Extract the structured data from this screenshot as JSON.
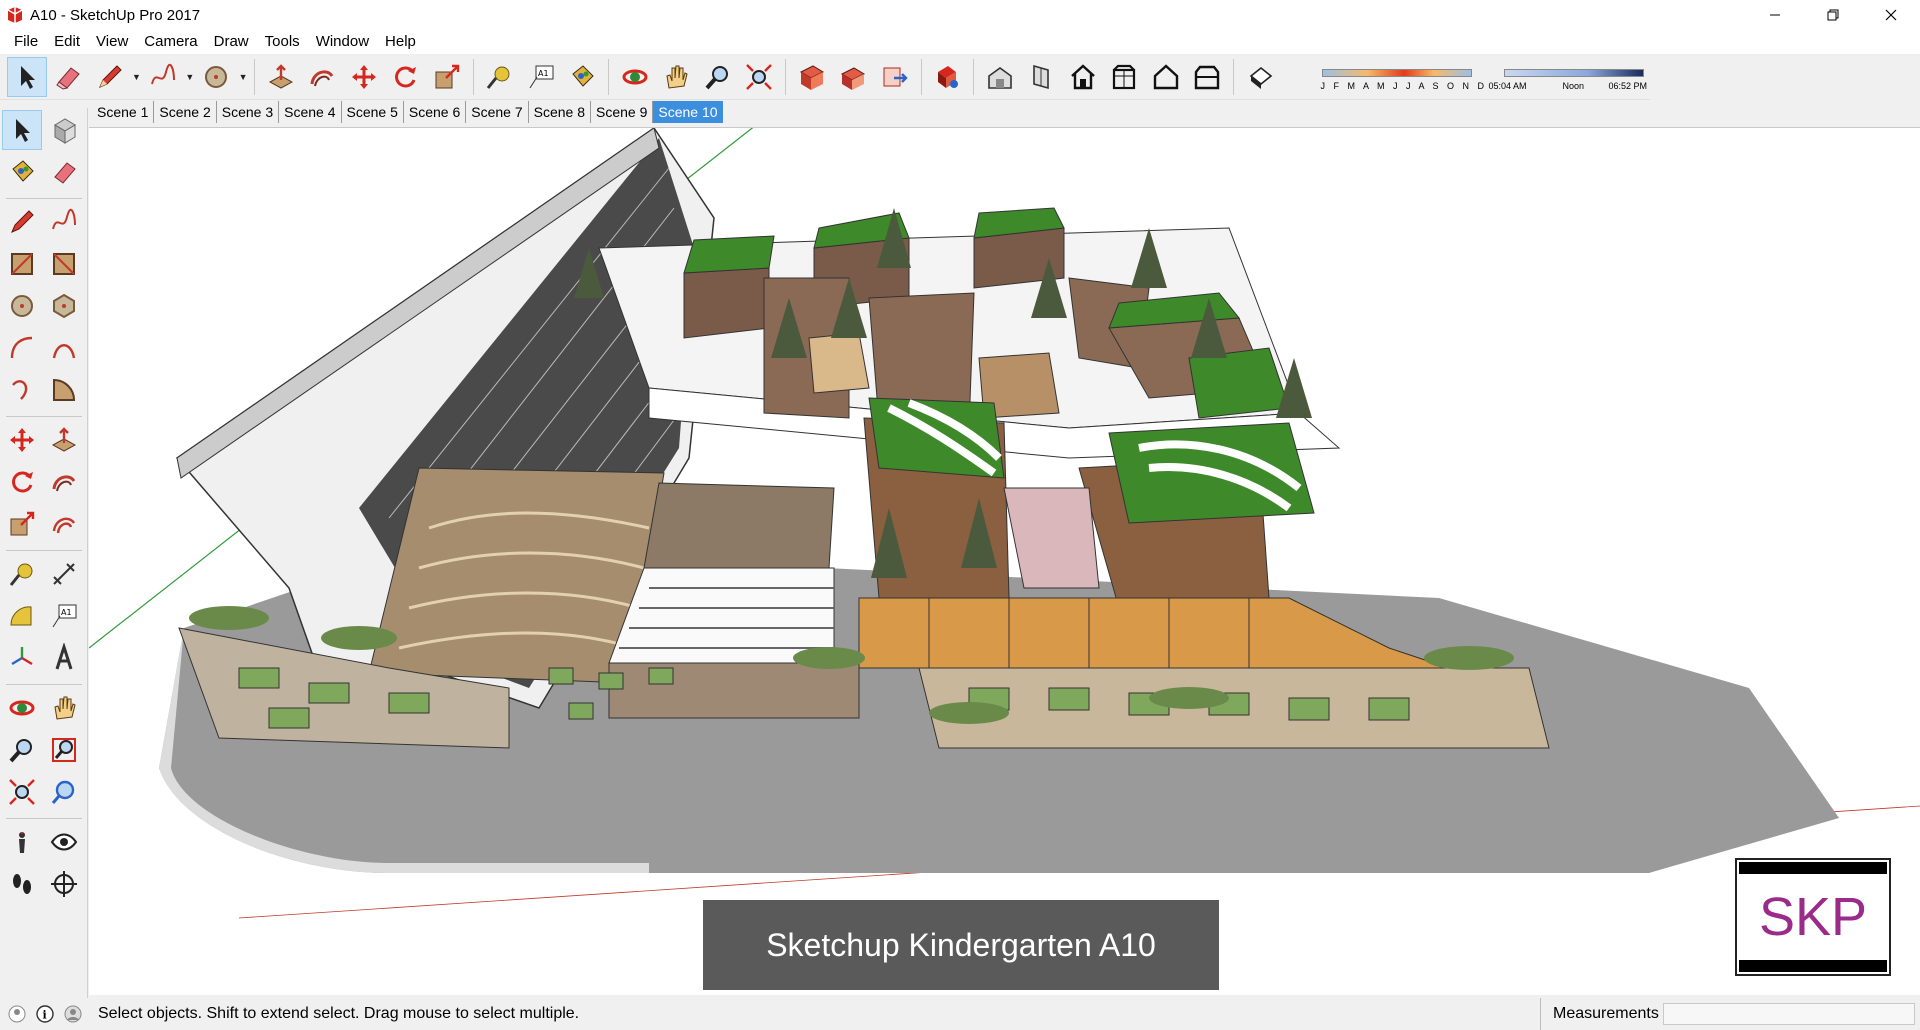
{
  "window": {
    "title": "A10 - SketchUp Pro 2017",
    "app_icon": "sketchup-logo-icon",
    "controls": [
      "minimize-icon",
      "restore-icon",
      "close-icon"
    ]
  },
  "menu": [
    "File",
    "Edit",
    "View",
    "Camera",
    "Draw",
    "Tools",
    "Window",
    "Help"
  ],
  "toolbar": {
    "tools": [
      "select-arrow-icon",
      "eraser-icon",
      "pencil-icon",
      "freehand-icon",
      "circle-icon",
      "push-pull-icon",
      "follow-me-icon",
      "move-icon",
      "rotate-icon",
      "scale-icon",
      "tape-measure-icon",
      "text-icon",
      "paint-bucket-icon",
      "orbit-icon",
      "pan-icon",
      "zoom-icon",
      "zoom-extents-icon",
      "section-plane-icon",
      "shadows-icon",
      "export-icon",
      "component-icon",
      "warehouse-icon",
      "house-front-icon",
      "house-back-icon",
      "house-top-icon",
      "house-left-icon",
      "house-right-icon",
      "shadow-settings-icon"
    ],
    "shadow_months": "J F M A M J J A S O N D",
    "shadow_time_start": "05:04 AM",
    "shadow_time_noon": "Noon",
    "shadow_time_end": "06:52 PM"
  },
  "scenes": [
    "Scene 1",
    "Scene 2",
    "Scene 3",
    "Scene 4",
    "Scene 5",
    "Scene 6",
    "Scene 7",
    "Scene 8",
    "Scene 9",
    "Scene 10"
  ],
  "active_scene": "Scene 10",
  "left_tools": [
    "select-icon",
    "make-component-icon",
    "paint-bucket-icon",
    "eraser-icon",
    "line-icon",
    "freehand-icon",
    "rectangle-icon",
    "rotated-rectangle-icon",
    "circle-icon",
    "polygon-icon",
    "arc-icon",
    "two-point-arc-icon",
    "three-point-arc-icon",
    "pie-icon",
    "move-icon",
    "push-pull-icon",
    "rotate-icon",
    "follow-me-icon",
    "scale-icon",
    "offset-icon",
    "tape-measure-icon",
    "dimension-icon",
    "protractor-icon",
    "text-icon",
    "axes-icon",
    "3d-text-icon",
    "orbit-icon",
    "pan-icon",
    "zoom-icon",
    "zoom-window-icon",
    "zoom-extents-icon",
    "previous-view-icon",
    "position-camera-icon",
    "look-around-icon",
    "walk-icon",
    "section-plane-icon"
  ],
  "viewport": {
    "caption": "Sketchup Kindergarten A10",
    "badge": "SKP"
  },
  "status": {
    "text": "Select objects. Shift to extend select. Drag mouse to select multiple.",
    "measurements_label": "Measurements",
    "measurements_value": ""
  }
}
